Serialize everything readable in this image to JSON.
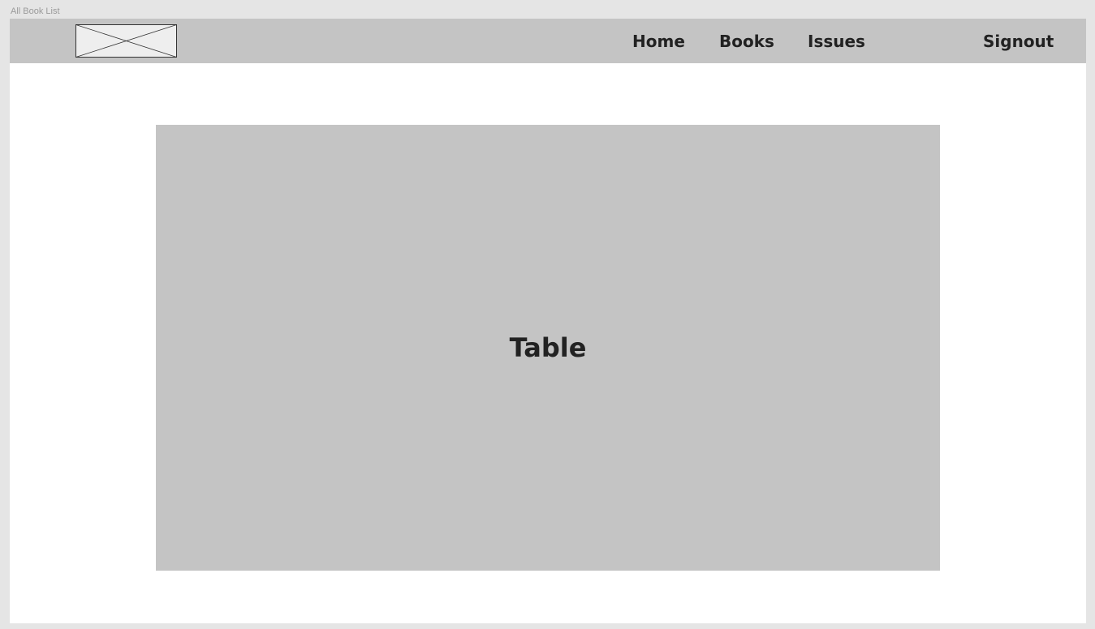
{
  "frame": {
    "label": "All Book List"
  },
  "navbar": {
    "logo_icon": "image-placeholder-icon",
    "links": {
      "home": "Home",
      "books": "Books",
      "issues": "Issues"
    },
    "signout": "Signout"
  },
  "main": {
    "table_label": "Table"
  },
  "colors": {
    "canvas": "#e5e5e5",
    "frame": "#ffffff",
    "navbar": "#c4c4c4",
    "placeholder": "#c4c4c4",
    "text": "#222222"
  }
}
